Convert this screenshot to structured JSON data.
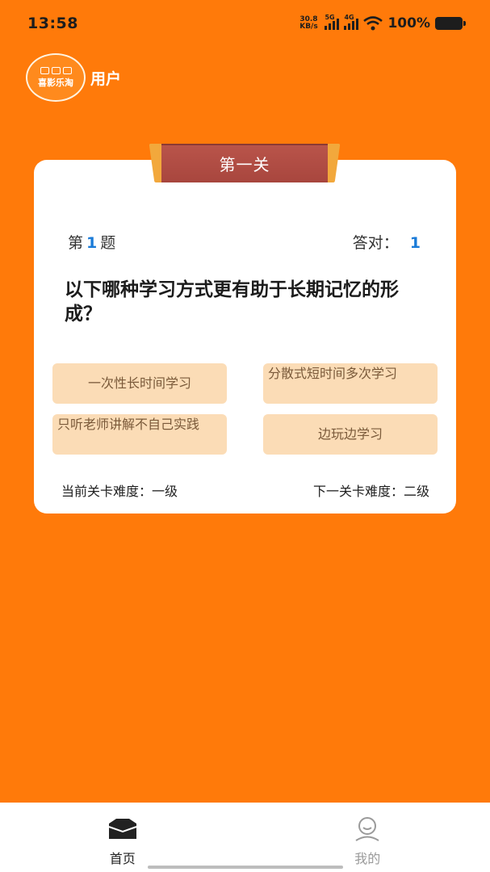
{
  "status_bar": {
    "time": "13:58",
    "net_speed_value": "30.8",
    "net_speed_unit": "KB/s",
    "signal1_label": "5G",
    "signal2_label": "4G",
    "battery_percent": "100%"
  },
  "header": {
    "logo_text": "喜影乐淘",
    "title": "用户"
  },
  "level": {
    "banner_title": "第一关",
    "question_prefix": "第",
    "question_number": "1",
    "question_suffix": "题",
    "correct_label": "答对：",
    "correct_count": "1",
    "question_text": "以下哪种学习方式更有助于长期记忆的形成？",
    "options": [
      {
        "label": "一次性长时间学习"
      },
      {
        "label": "分散式短时间多次学习"
      },
      {
        "label": "只听老师讲解不自己实践"
      },
      {
        "label": "边玩边学习"
      }
    ],
    "current_difficulty": "当前关卡难度：一级",
    "next_difficulty": "下一关卡难度：二级"
  },
  "tab_bar": {
    "tabs": [
      {
        "label": "首页",
        "icon": "home-icon",
        "active": true
      },
      {
        "label": "我的",
        "icon": "user-icon",
        "active": false
      }
    ]
  },
  "colors": {
    "background": "#ff7a0a",
    "option_bg": "#fbdcb6",
    "banner": "#a8463e",
    "accent_number": "#1a7bd8"
  }
}
